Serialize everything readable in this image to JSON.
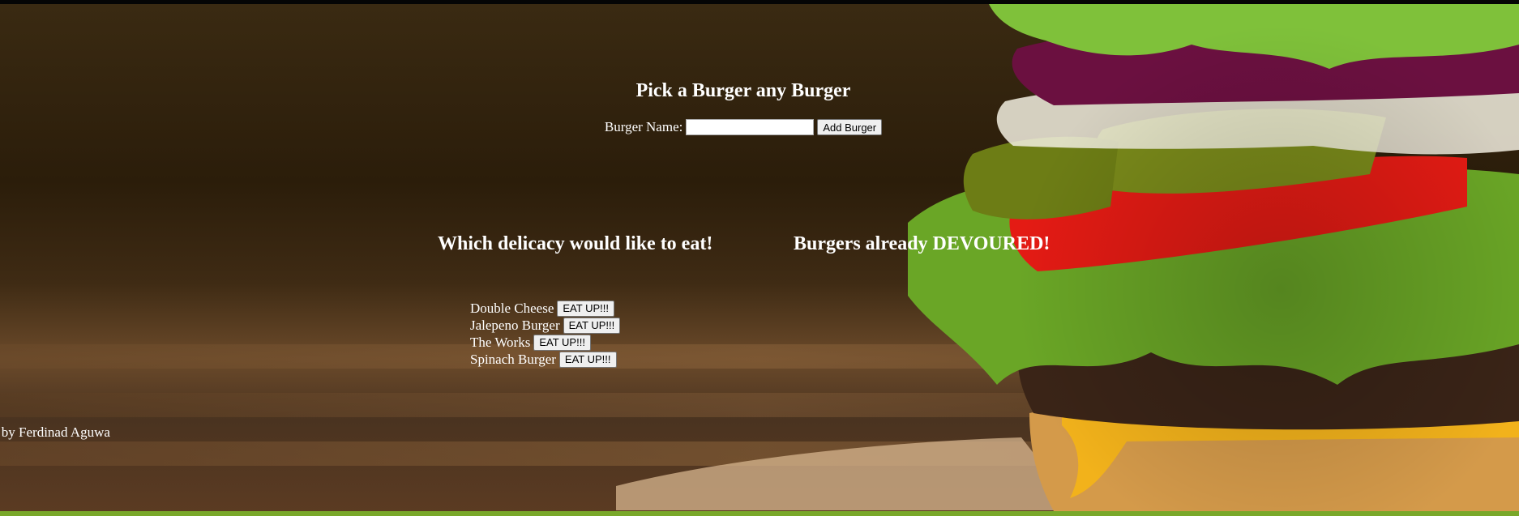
{
  "header": {
    "title": "Pick a Burger any Burger"
  },
  "form": {
    "label": "Burger Name:",
    "input_value": "",
    "add_button": "Add Burger"
  },
  "sections": {
    "to_eat_title": "Which delicacy would like to eat!",
    "devoured_title": "Burgers already DEVOURED!"
  },
  "burgers_to_eat": [
    {
      "name": "Double Cheese",
      "button": "EAT UP!!!"
    },
    {
      "name": "Jalepeno Burger",
      "button": "EAT UP!!!"
    },
    {
      "name": "The Works",
      "button": "EAT UP!!!"
    },
    {
      "name": "Spinach Burger",
      "button": "EAT UP!!!"
    }
  ],
  "footer": {
    "text": "e by Ferdinad Aguwa"
  },
  "colors": {
    "accent": "#79a82a",
    "text": "#ffffff"
  }
}
